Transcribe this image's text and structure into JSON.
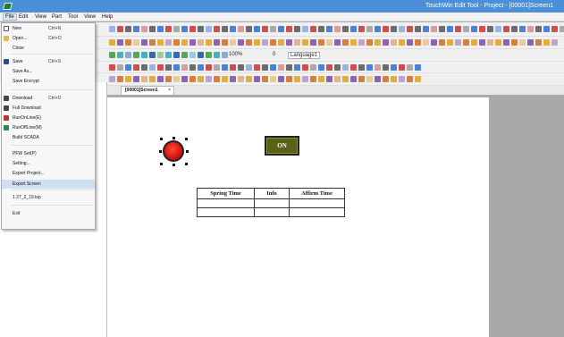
{
  "title_bar": {
    "title": "TouchWin Edit Tool - Project - [00001]Screen1"
  },
  "menu_bar": {
    "items": [
      "File",
      "Edit",
      "View",
      "Part",
      "Tool",
      "View",
      "Help"
    ]
  },
  "toolbar": {
    "zoom_value": "100%",
    "number_value": "0",
    "language_value": "Language1",
    "icon_names": [
      "save-icon",
      "font-icon",
      "align-icon",
      "shape-icon",
      "color-icon",
      "grid-icon",
      "download-icon",
      "zoom-icon",
      "text-tools-icon"
    ]
  },
  "file_menu": {
    "items": [
      {
        "label": "New",
        "shortcut": "Ctrl+N",
        "icon": "new-file-icon"
      },
      {
        "label": "Open...",
        "shortcut": "Ctrl+O",
        "icon": "open-folder-icon"
      },
      {
        "label": "Close",
        "shortcut": "",
        "icon": ""
      },
      {
        "label": "Save",
        "shortcut": "Ctrl+S",
        "icon": "save-icon"
      },
      {
        "label": "Save As...",
        "shortcut": "",
        "icon": ""
      },
      {
        "label": "Save Encrypt",
        "shortcut": "",
        "icon": ""
      },
      {
        "label": "Download",
        "shortcut": "Ctrl+D",
        "icon": "download-icon"
      },
      {
        "label": "Full Download",
        "shortcut": "",
        "icon": "full-download-icon"
      },
      {
        "label": "RunOnLine(E)",
        "shortcut": "",
        "icon": "run-online-icon"
      },
      {
        "label": "RunOffLine(M)",
        "shortcut": "",
        "icon": "run-offline-icon"
      },
      {
        "label": "Build SCADA",
        "shortcut": "",
        "icon": ""
      },
      {
        "label": "PFW Set(P)",
        "shortcut": "",
        "icon": ""
      },
      {
        "label": "Setting...",
        "shortcut": "",
        "icon": ""
      },
      {
        "label": "Export Project...",
        "shortcut": "",
        "icon": ""
      },
      {
        "label": "Export Screen",
        "shortcut": "",
        "icon": ""
      },
      {
        "label": "1 27_2_19.txp",
        "shortcut": "",
        "icon": ""
      },
      {
        "label": "Exit",
        "shortcut": "",
        "icon": ""
      }
    ],
    "highlighted": "Export Screen"
  },
  "tab": {
    "label": "[00001]Screen1",
    "close": "×"
  },
  "screen": {
    "button_label": "ON",
    "table": {
      "headers": [
        "Spring Time",
        "Info",
        "Affirm Time"
      ],
      "rows": [
        [
          "",
          "",
          ""
        ],
        [
          "",
          "",
          ""
        ]
      ]
    }
  },
  "colors": {
    "title_bar": "#4a8fd8",
    "lamp_red": "#d2140c",
    "button_olive": "#5a6118",
    "menu_highlight": "#cfe0f5"
  }
}
